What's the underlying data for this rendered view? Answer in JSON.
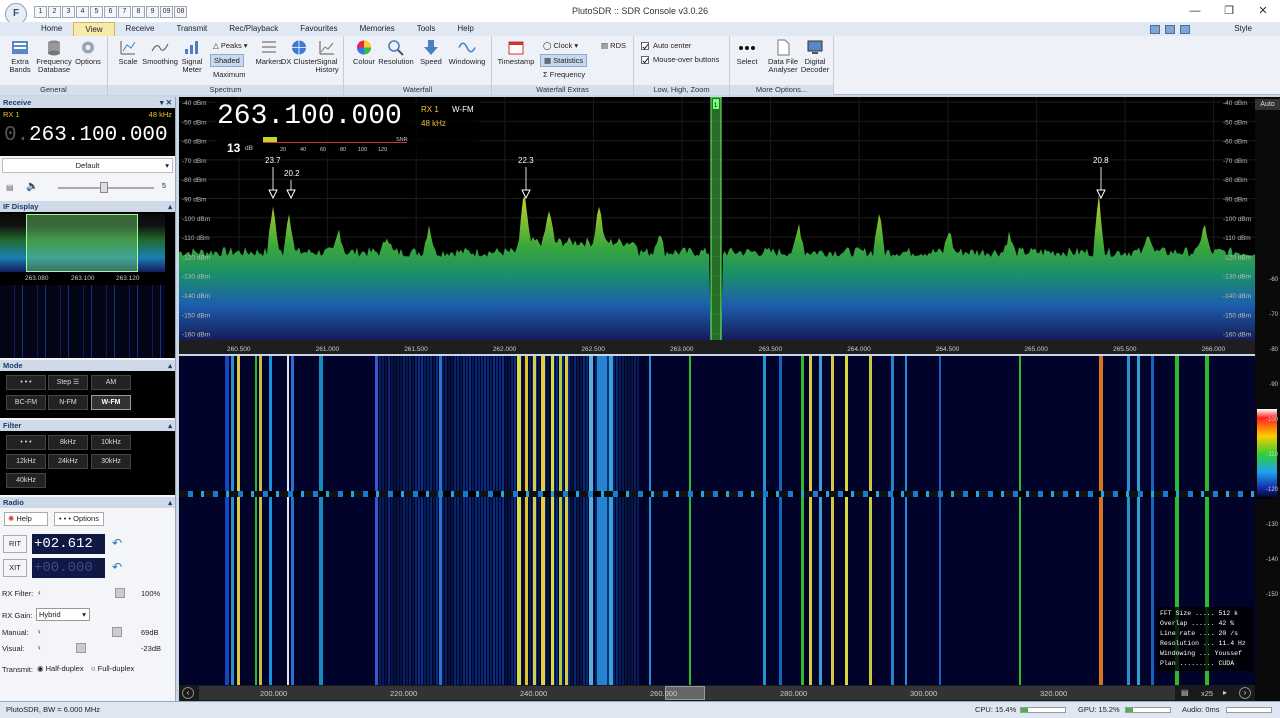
{
  "window": {
    "title": "PlutoSDR :: SDR Console v3.0.26",
    "app_badge": "F",
    "qat": [
      "1",
      "2",
      "3",
      "4",
      "5",
      "6",
      "7",
      "8",
      "9",
      "09",
      "08"
    ],
    "style_label": "Style"
  },
  "menu": {
    "tabs": [
      "Home",
      "View",
      "Receive",
      "Transmit",
      "Rec/Playback",
      "Favourites",
      "Memories",
      "Tools",
      "Help"
    ],
    "active": "View"
  },
  "ribbon": {
    "general": {
      "caption": "General",
      "buttons": [
        "Extra Bands",
        "Frequency Database",
        "Options"
      ]
    },
    "spectrum": {
      "caption": "Spectrum",
      "buttons": [
        "Scale",
        "Smoothing",
        "Signal Meter",
        "Markers",
        "DX Cluster",
        "Signal History"
      ],
      "peaks": "Peaks",
      "shaded": "Shaded",
      "maximum": "Maximum"
    },
    "waterfall": {
      "caption": "Waterfall",
      "buttons": [
        "Colour",
        "Resolution",
        "Speed",
        "Windowing"
      ]
    },
    "extras": {
      "caption": "Waterfall Extras",
      "timestamp": "Timestamp",
      "clock": "Clock",
      "statistics": "Statistics",
      "frequency": "Frequency",
      "rds": "RDS"
    },
    "lhz": {
      "caption": "Low, High, Zoom",
      "auto_center": "Auto center",
      "mouse_over": "Mouse-over buttons"
    },
    "more": {
      "caption": "More Options...",
      "buttons": [
        "Select",
        "Data File Analyser",
        "Digital Decoder"
      ]
    }
  },
  "receive": {
    "header": "Receive",
    "rx": "RX 1",
    "bw": "48 kHz",
    "freq_dim": "0.",
    "freq": "263.100.000",
    "preset": "Default",
    "vol": "5"
  },
  "if_display": {
    "header": "IF Display",
    "ticks": [
      "263.080",
      "263.100",
      "263.120"
    ]
  },
  "mode": {
    "header": "Mode",
    "buttons": [
      "• • •",
      "Step ☰",
      "AM",
      "BC-FM",
      "N-FM",
      "W-FM"
    ],
    "selected": "W-FM"
  },
  "filter": {
    "header": "Filter",
    "buttons": [
      "• • •",
      "8kHz",
      "10kHz",
      "12kHz",
      "24kHz",
      "30kHz",
      "40kHz"
    ]
  },
  "radio": {
    "header": "Radio",
    "help": "Help",
    "options": "• • • Options",
    "rit_label": "RIT",
    "rit": "+02.612",
    "xit_label": "XIT",
    "xit": "+00.000",
    "rx_filter_label": "RX Filter:",
    "rx_filter": "100%",
    "rx_gain_label": "RX Gain:",
    "rx_gain": "Hybrid",
    "manual_label": "Manual:",
    "manual": "69dB",
    "visual_label": "Visual:",
    "visual": "-23dB",
    "transmit_label": "Transmit:",
    "half": "Half-duplex",
    "full": "Full-duplex"
  },
  "spectrum": {
    "freq": "263.100.000",
    "rx": "RX 1",
    "mode": "W-FM",
    "bw": "48 kHz",
    "snr": "13",
    "snr_unit": "dB",
    "snr_label": "SNR",
    "snr_scale": [
      "20",
      "40",
      "60",
      "80",
      "100",
      "120"
    ],
    "dbm_labels": [
      "-40 dBm",
      "-50 dBm",
      "-60 dBm",
      "-70 dBm",
      "-80 dBm",
      "-90 dBm",
      "-100 dBm",
      "-110 dBm",
      "-120 dBm",
      "-130 dBm",
      "-140 dBm",
      "-150 dBm",
      "-160 dBm"
    ],
    "freq_ticks": [
      "260.500",
      "261.000",
      "261.500",
      "262.000",
      "262.500",
      "263.000",
      "263.500",
      "264.000",
      "264.500",
      "265.000",
      "265.500",
      "266.000"
    ],
    "peaks": [
      "23.7",
      "20.2",
      "22.3",
      "20.8"
    ],
    "auto": "Auto"
  },
  "waterfall": {
    "time_ticks": [
      "200.000",
      "220.000",
      "240.000",
      "260.000",
      "280.000",
      "300.000",
      "320.000"
    ],
    "zoom": "x25",
    "stats": [
      "FFT Size ..... 512 k",
      "Overlap ...... 42 %",
      "Line rate .... 20 /s",
      "Resolution ... 11.4 Hz",
      "Windowing ... Youssef",
      "Plan ......... CUDA"
    ],
    "scale": [
      "-60",
      "-70",
      "-80",
      "-90",
      "-100",
      "-110",
      "-120",
      "-130",
      "-140",
      "-150"
    ]
  },
  "status": {
    "left": "PlutoSDR, BW = 6.000 MHz",
    "cpu": "CPU: 15.4%",
    "gpu": "GPU: 15.2%",
    "audio": "Audio: 0ms"
  },
  "colors": {
    "accent": "#3d6fb0",
    "spectrum_peak": "#c8d22a",
    "spectrum_base": "#1a8f3a",
    "tab_active": "#f7e9a8"
  }
}
